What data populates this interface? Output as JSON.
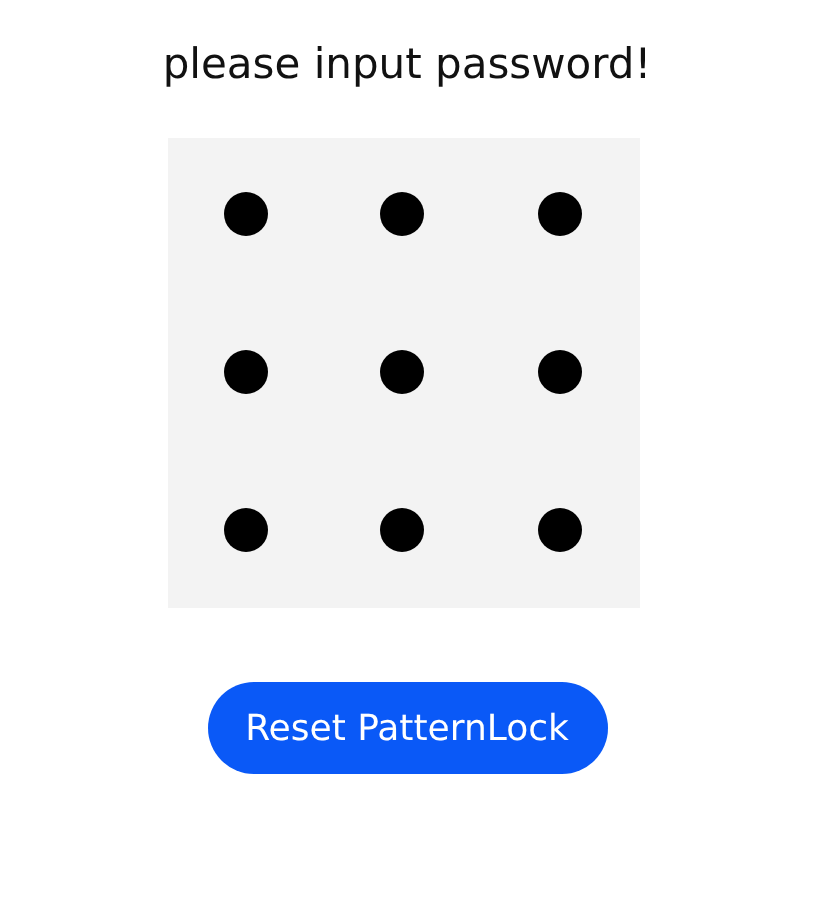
{
  "title": "please input password!",
  "button": {
    "label": "Reset PatternLock"
  }
}
